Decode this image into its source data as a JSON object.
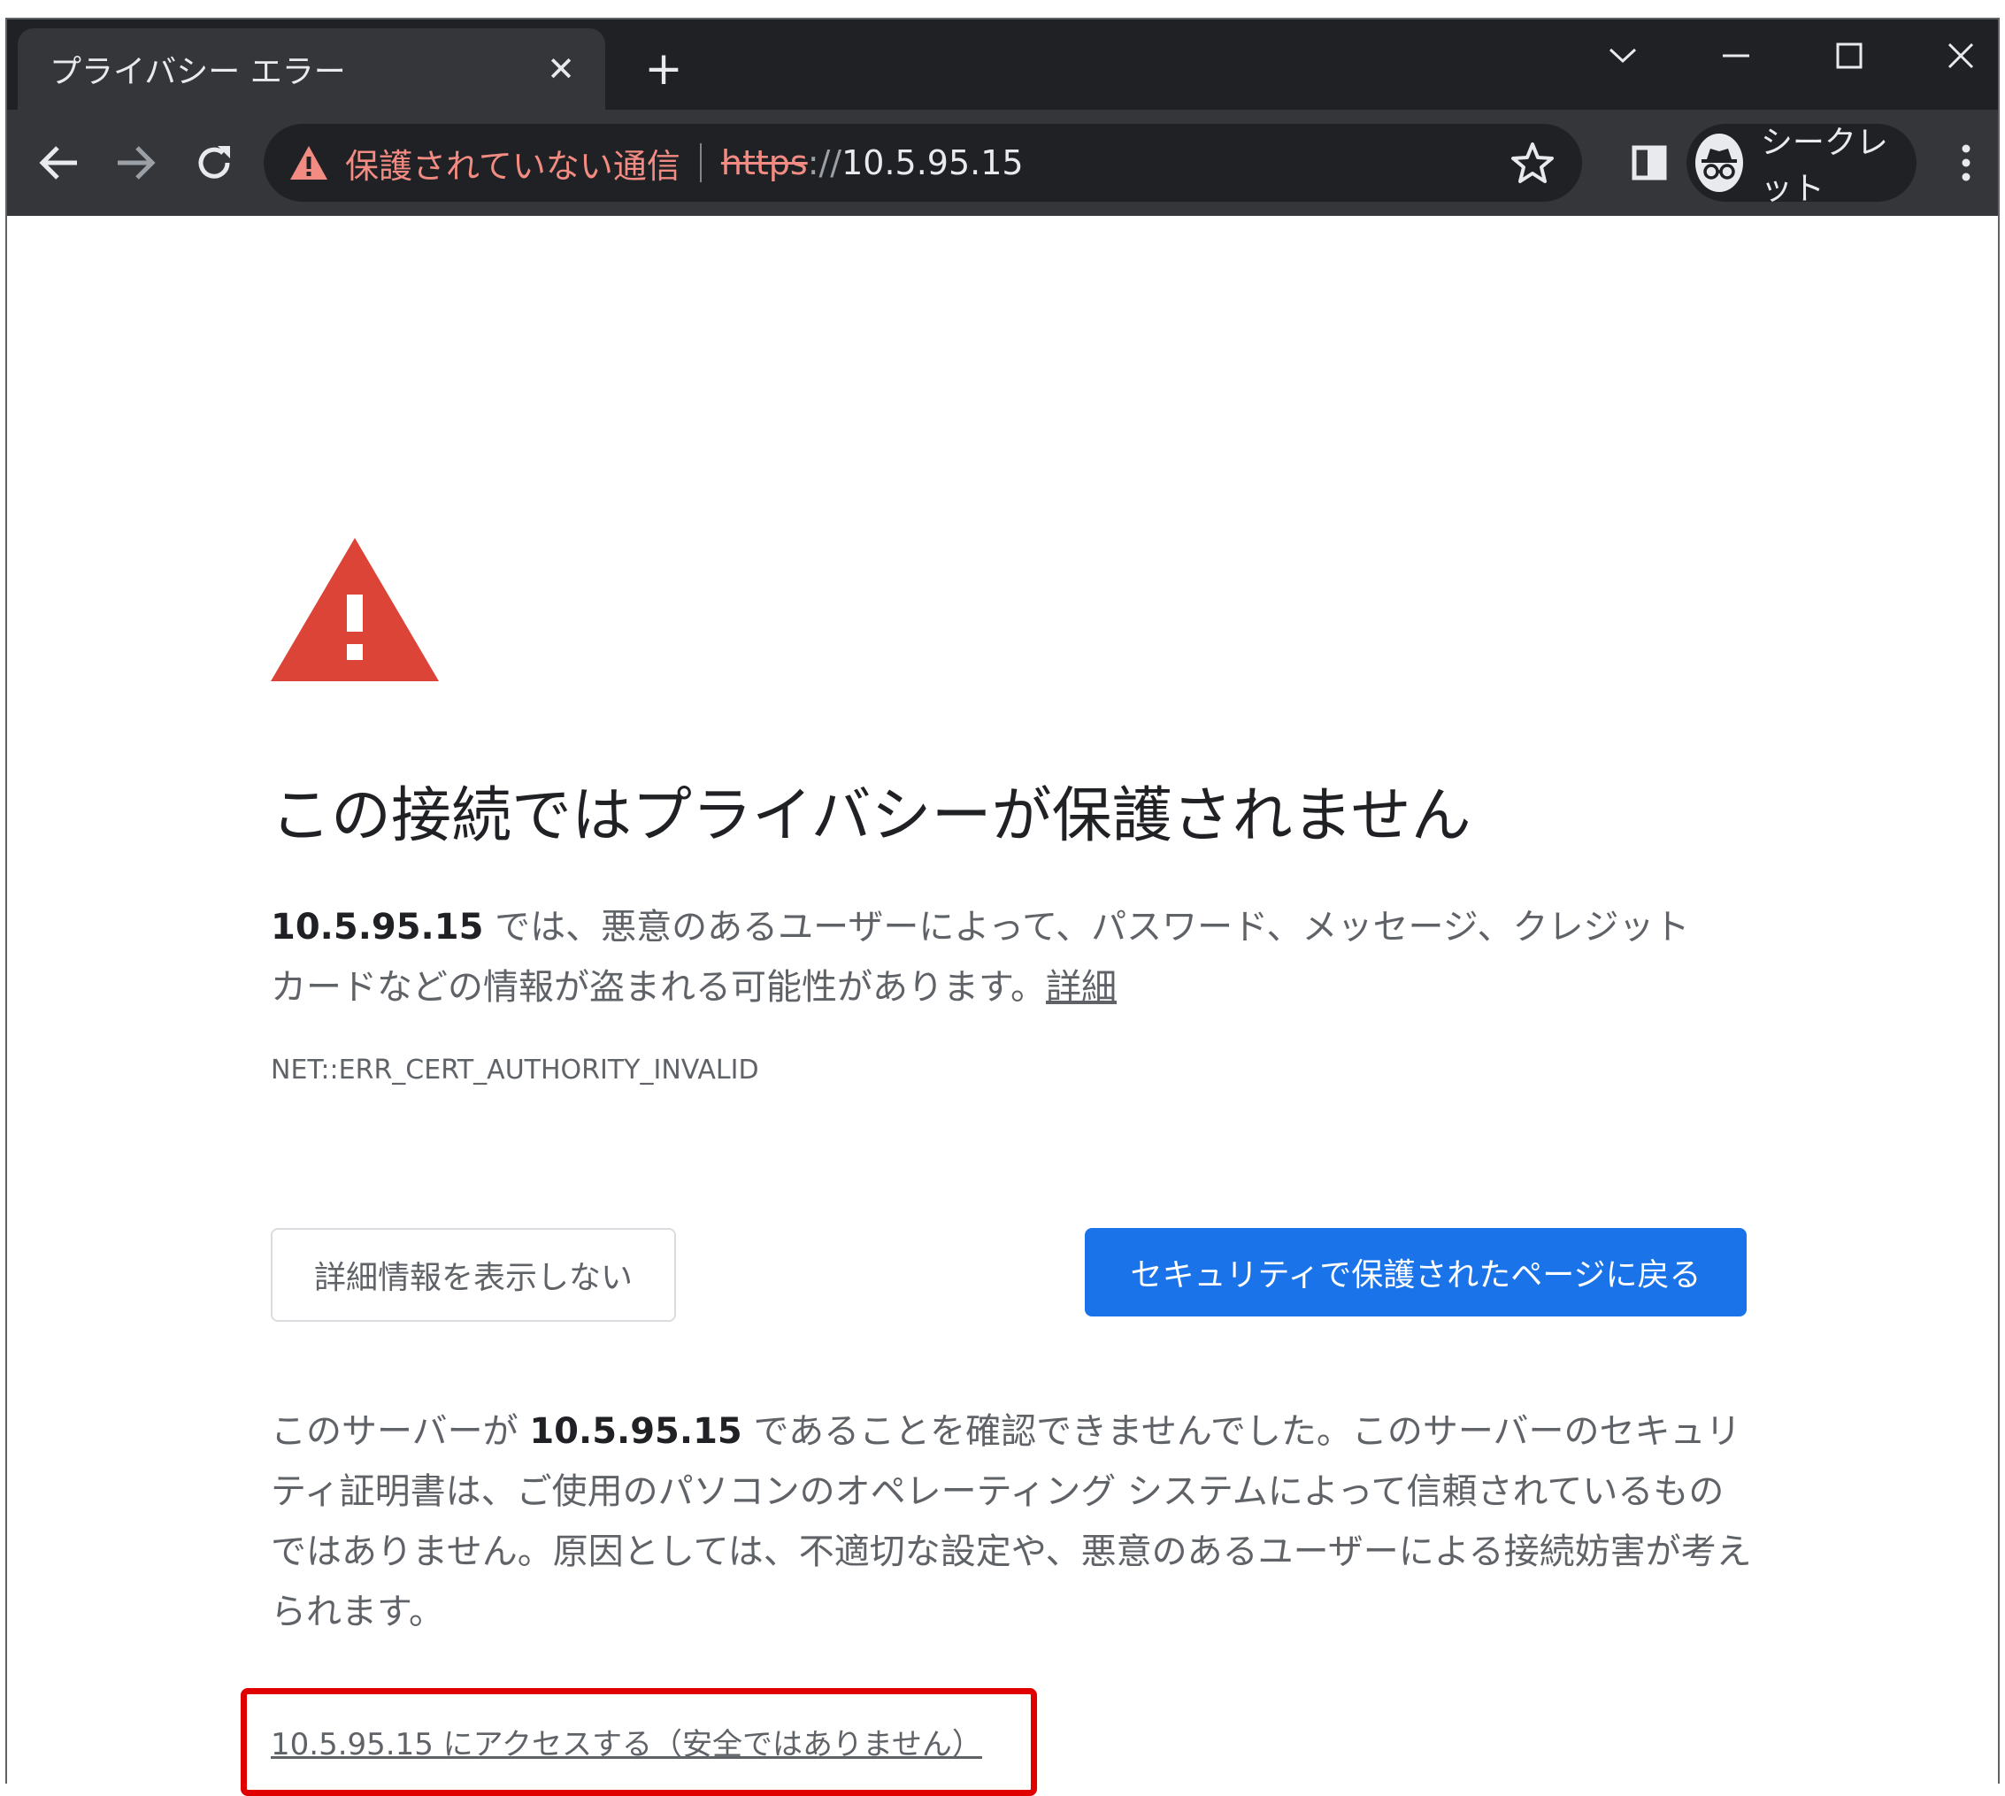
{
  "tab": {
    "title": "プライバシー エラー",
    "close_glyph": "✕",
    "new_tab_glyph": "+"
  },
  "omnibox": {
    "security_status": "保護されていない通信",
    "scheme": "https",
    "slashes": "://",
    "host": "10.5.95.15"
  },
  "profile": {
    "label": "シークレット"
  },
  "page": {
    "heading": "この接続ではプライバシーが保護されません",
    "intro_host": "10.5.95.15",
    "intro_line1_rest": " では、悪意のあるユーザーによって、パスワード、メッセージ、クレジット",
    "intro_line2": "カードなどの情報が盗まれる可能性があります。",
    "details_link": "詳細",
    "error_code": "NET::ERR_CERT_AUTHORITY_INVALID",
    "hide_details_button": "詳細情報を表示しない",
    "back_to_safety_button": "セキュリティで保護されたページに戻る",
    "explanation_prefix": "このサーバーが ",
    "explanation_host": "10.5.95.15",
    "explanation_suffix": " であることを確認できませんでした。このサーバーのセキュリティ証明書は、ご使用のパソコンのオペレーティング システムによって信頼されているものではありません。原因としては、不適切な設定や、悪意のあるユーザーによる接続妨害が考えられます。",
    "proceed_link": "10.5.95.15 にアクセスする（安全ではありません）"
  },
  "colors": {
    "titlebar": "#202124",
    "toolbar": "#35363a",
    "warning_red": "#f28b82",
    "primary_blue": "#1a73e8",
    "highlight_box": "#e00000"
  }
}
